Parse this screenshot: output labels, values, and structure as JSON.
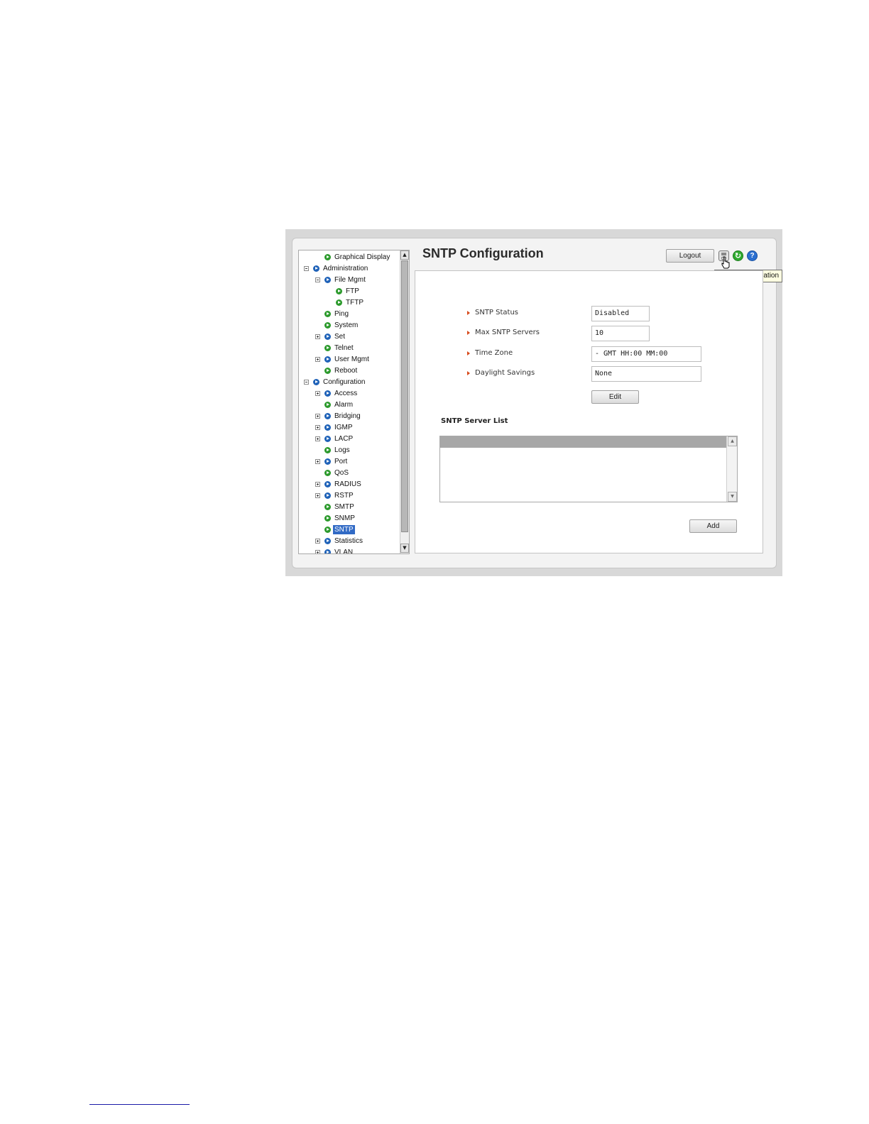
{
  "sidebar": {
    "items": [
      {
        "label": "Graphical Display",
        "bullet": "green"
      },
      {
        "label": "Administration",
        "bullet": "blue",
        "expander": "minus"
      },
      {
        "label": "File Mgmt",
        "bullet": "blue",
        "expander": "minus"
      },
      {
        "label": "FTP",
        "bullet": "green"
      },
      {
        "label": "TFTP",
        "bullet": "green"
      },
      {
        "label": "Ping",
        "bullet": "green"
      },
      {
        "label": "System",
        "bullet": "green"
      },
      {
        "label": "Set",
        "bullet": "blue",
        "expander": "plus"
      },
      {
        "label": "Telnet",
        "bullet": "green"
      },
      {
        "label": "User Mgmt",
        "bullet": "blue",
        "expander": "plus"
      },
      {
        "label": "Reboot",
        "bullet": "green"
      },
      {
        "label": "Configuration",
        "bullet": "blue",
        "expander": "minus"
      },
      {
        "label": "Access",
        "bullet": "blue",
        "expander": "plus"
      },
      {
        "label": "Alarm",
        "bullet": "green"
      },
      {
        "label": "Bridging",
        "bullet": "blue",
        "expander": "plus"
      },
      {
        "label": "IGMP",
        "bullet": "blue",
        "expander": "plus"
      },
      {
        "label": "LACP",
        "bullet": "blue",
        "expander": "plus"
      },
      {
        "label": "Logs",
        "bullet": "green"
      },
      {
        "label": "Port",
        "bullet": "blue",
        "expander": "plus"
      },
      {
        "label": "QoS",
        "bullet": "green"
      },
      {
        "label": "RADIUS",
        "bullet": "blue",
        "expander": "plus"
      },
      {
        "label": "RSTP",
        "bullet": "blue",
        "expander": "plus"
      },
      {
        "label": "SMTP",
        "bullet": "green"
      },
      {
        "label": "SNMP",
        "bullet": "green"
      },
      {
        "label": "SNTP",
        "bullet": "green",
        "selected": true
      },
      {
        "label": "Statistics",
        "bullet": "blue",
        "expander": "plus"
      },
      {
        "label": "VLAN",
        "bullet": "blue",
        "expander": "plus"
      }
    ]
  },
  "header": {
    "title": "SNTP Configuration",
    "logout_label": "Logout",
    "tooltip": "Save Configuration",
    "icons": [
      "save-icon",
      "refresh-icon",
      "help-icon"
    ]
  },
  "form": {
    "fields": [
      {
        "label": "SNTP Status",
        "value": "Disabled"
      },
      {
        "label": "Max SNTP Servers",
        "value": "10"
      },
      {
        "label": "Time Zone",
        "value": "- GMT HH:00 MM:00"
      },
      {
        "label": "Daylight Savings",
        "value": "None"
      }
    ],
    "edit_label": "Edit"
  },
  "server_list": {
    "title": "SNTP Server List",
    "add_label": "Add"
  },
  "colors": {
    "accent": "#316ac5",
    "bullet_green": "#2c9a2c",
    "bullet_blue": "#1f62b8",
    "field_marker": "#d84a1b"
  }
}
